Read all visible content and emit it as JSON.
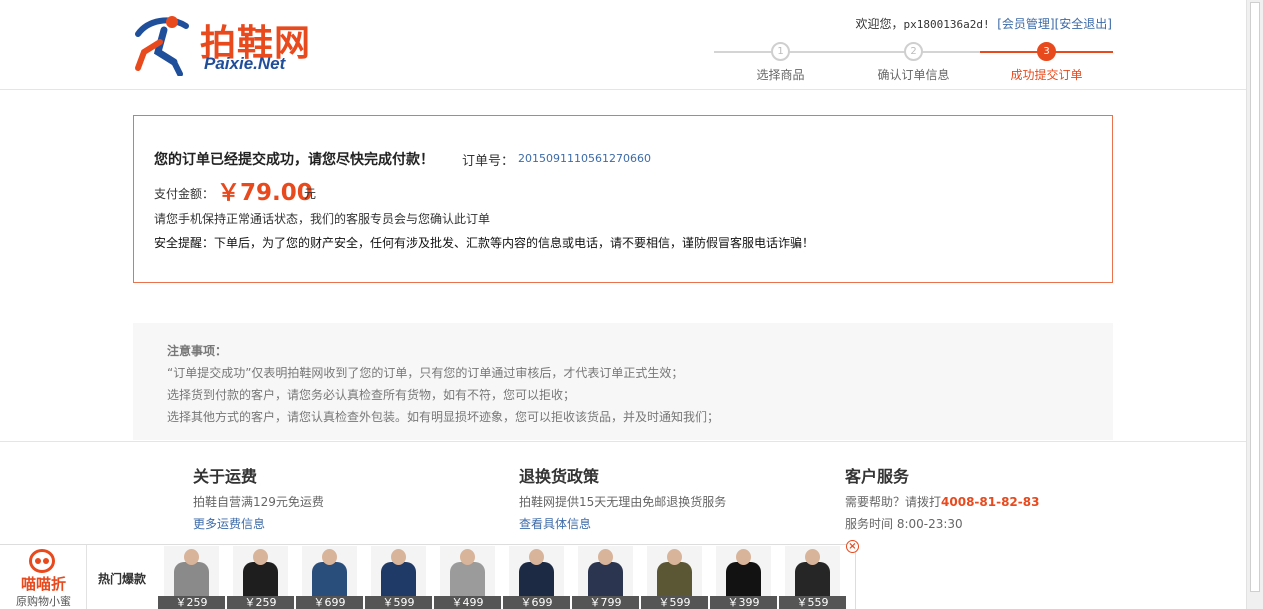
{
  "header": {
    "logo_cn": "拍鞋网",
    "logo_en": "Paixie.Net",
    "welcome_prefix": "欢迎您，",
    "username": "px1800136a2d!",
    "member_link": "[会员管理]",
    "logout_link": "[安全退出]"
  },
  "steps": [
    {
      "num": "1",
      "label": "选择商品"
    },
    {
      "num": "2",
      "label": "确认订单信息"
    },
    {
      "num": "3",
      "label": "成功提交订单"
    }
  ],
  "order": {
    "title": "您的订单已经提交成功，请您尽快完成付款！",
    "order_no_label": "订单号：",
    "order_no": "2015091110561270660",
    "amount_label": "支付金额：",
    "amount": "￥79.00",
    "unit": "元",
    "note1": "请您手机保持正常通话状态，我们的客服专员会与您确认此订单",
    "note2": "安全提醒：下单后，为了您的财产安全，任何有涉及批发、汇款等内容的信息或电话，请不要相信，谨防假冒客服电话诈骗！"
  },
  "notes": {
    "title": "注意事项：",
    "lines": [
      "“订单提交成功”仅表明拍鞋网收到了您的订单，只有您的订单通过审核后，才代表订单正式生效；",
      "选择货到付款的客户，请您务必认真检查所有货物，如有不符，您可以拒收；",
      "选择其他方式的客户，请您认真检查外包装。如有明显损坏迹象，您可以拒收该货品，并及时通知我们；"
    ]
  },
  "footer": {
    "shipping": {
      "title": "关于运费",
      "text": "拍鞋自营满129元免运费",
      "link": "更多运费信息"
    },
    "returns": {
      "title": "退换货政策",
      "text": "拍鞋网提供15天无理由免邮退换货服务",
      "link": "查看具体信息"
    },
    "service": {
      "title": "客户服务",
      "text": "需要帮助？请拨打",
      "phone": "4008-81-82-83",
      "hours": "服务时间 8:00-23:30"
    }
  },
  "bottom_bar": {
    "brand": "喵喵折",
    "brand_sub": "原购物小蜜",
    "hot_label": "热门爆款",
    "close": "×",
    "products": [
      {
        "price": "￥259",
        "color": "#8a8a8a"
      },
      {
        "price": "￥259",
        "color": "#1e1e1e"
      },
      {
        "price": "￥699",
        "color": "#2a4e7c"
      },
      {
        "price": "￥599",
        "color": "#1f3a66"
      },
      {
        "price": "￥499",
        "color": "#9b9b9b"
      },
      {
        "price": "￥699",
        "color": "#1c2a44"
      },
      {
        "price": "￥799",
        "color": "#2b3550"
      },
      {
        "price": "￥599",
        "color": "#5b5634"
      },
      {
        "price": "￥399",
        "color": "#121212"
      },
      {
        "price": "￥559",
        "color": "#262626"
      }
    ]
  }
}
